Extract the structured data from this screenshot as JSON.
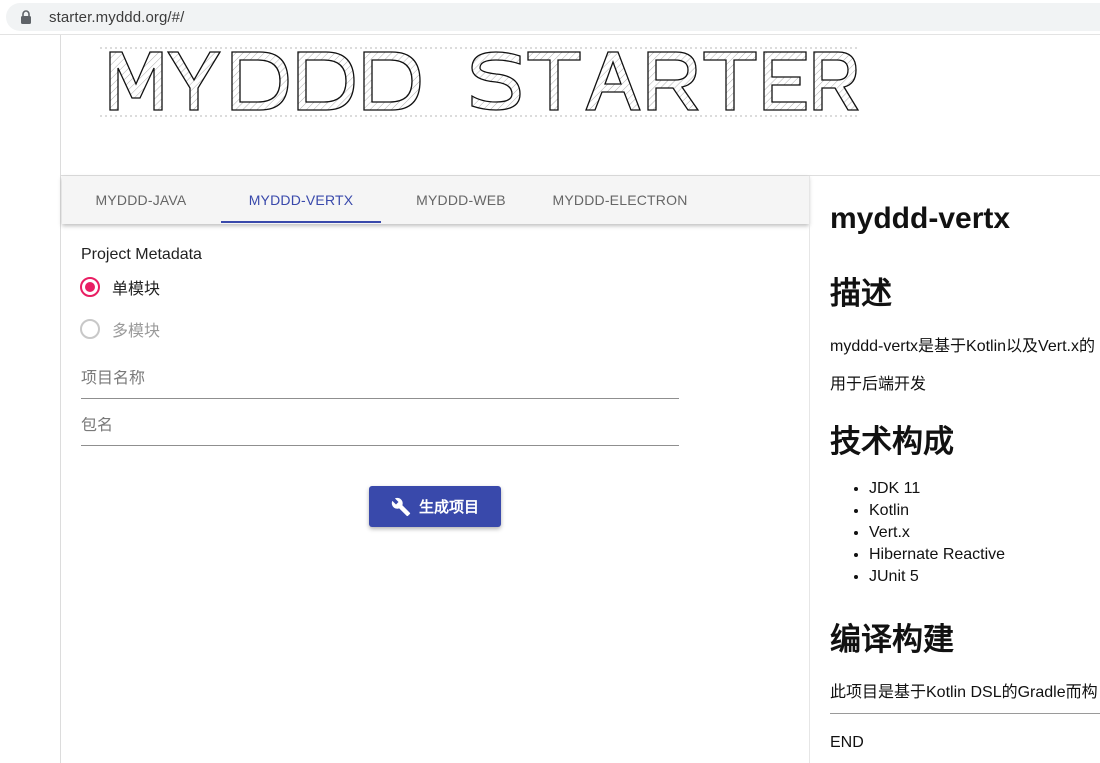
{
  "browser": {
    "url": "starter.myddd.org/#/"
  },
  "logo": {
    "text": "MYDDD STARTER"
  },
  "tabs": [
    {
      "label": "MYDDD-JAVA",
      "active": false
    },
    {
      "label": "MYDDD-VERTX",
      "active": true
    },
    {
      "label": "MYDDD-WEB",
      "active": false
    },
    {
      "label": "MYDDD-ELECTRON",
      "active": false
    }
  ],
  "form": {
    "section_label": "Project Metadata",
    "radio_options": [
      {
        "label": "单模块",
        "selected": true
      },
      {
        "label": "多模块",
        "selected": false
      }
    ],
    "project_name": {
      "placeholder": "项目名称",
      "value": ""
    },
    "package_name": {
      "placeholder": "包名",
      "value": ""
    },
    "generate_button": "生成项目"
  },
  "doc": {
    "title": "myddd-vertx",
    "desc_heading": "描述",
    "desc_line1": "myddd-vertx是基于Kotlin以及Vert.x的",
    "desc_line2": "用于后端开发",
    "tech_heading": "技术构成",
    "tech_items": [
      "JDK 11",
      "Kotlin",
      "Vert.x",
      "Hibernate Reactive",
      "JUnit 5"
    ],
    "build_heading": "编译构建",
    "build_line": "此项目是基于Kotlin DSL的Gradle而构",
    "end": "END"
  },
  "colors": {
    "accent": "#3949ab",
    "radio": "#e91e63",
    "tab_bar": "#f5f5f5"
  }
}
